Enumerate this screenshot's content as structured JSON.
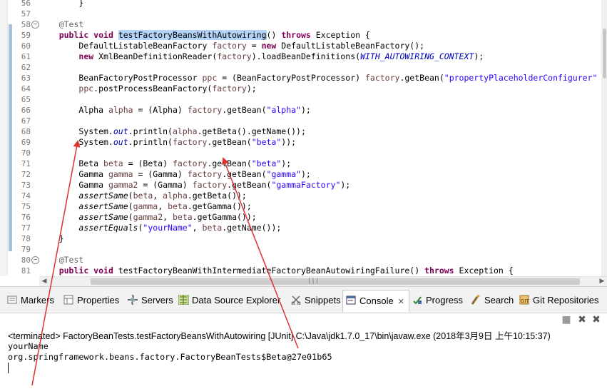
{
  "editor": {
    "lines": [
      {
        "n": "56",
        "parts": [
          [
            "        }",
            ""
          ]
        ]
      },
      {
        "n": "57",
        "parts": [
          [
            "",
            ""
          ]
        ]
      },
      {
        "n": "58",
        "fold": "−",
        "parts": [
          [
            "    ",
            ""
          ],
          [
            "@Test",
            "ann"
          ]
        ]
      },
      {
        "n": "59",
        "parts": [
          [
            "    ",
            ""
          ],
          [
            "public void",
            "kw"
          ],
          [
            " ",
            ""
          ],
          [
            "testFactoryBeansWithAutowiring",
            "sel"
          ],
          [
            "() ",
            ""
          ],
          [
            "throws",
            "kw"
          ],
          [
            " Exception {",
            ""
          ]
        ]
      },
      {
        "n": "60",
        "parts": [
          [
            "        DefaultListableBeanFactory ",
            ""
          ],
          [
            "factory",
            "vr"
          ],
          [
            " = ",
            ""
          ],
          [
            "new",
            "kw"
          ],
          [
            " DefaultListableBeanFactory();",
            ""
          ]
        ]
      },
      {
        "n": "61",
        "parts": [
          [
            "        ",
            ""
          ],
          [
            "new",
            "kw"
          ],
          [
            " XmlBeanDefinitionReader(",
            ""
          ],
          [
            "factory",
            "vr"
          ],
          [
            ").loadBeanDefinitions(",
            ""
          ],
          [
            "WITH_AUTOWIRING_CONTEXT",
            "fld"
          ],
          [
            ");",
            ""
          ]
        ]
      },
      {
        "n": "62",
        "parts": [
          [
            "",
            ""
          ]
        ]
      },
      {
        "n": "63",
        "parts": [
          [
            "        BeanFactoryPostProcessor ",
            ""
          ],
          [
            "ppc",
            "vr"
          ],
          [
            " = (BeanFactoryPostProcessor) ",
            ""
          ],
          [
            "factory",
            "vr"
          ],
          [
            ".getBean(",
            ""
          ],
          [
            "\"propertyPlaceholderConfigurer\"",
            "str"
          ]
        ]
      },
      {
        "n": "64",
        "parts": [
          [
            "        ",
            ""
          ],
          [
            "ppc",
            "vr"
          ],
          [
            ".postProcessBeanFactory(",
            ""
          ],
          [
            "factory",
            "vr"
          ],
          [
            ");",
            ""
          ]
        ]
      },
      {
        "n": "65",
        "parts": [
          [
            "",
            ""
          ]
        ]
      },
      {
        "n": "66",
        "parts": [
          [
            "        Alpha ",
            ""
          ],
          [
            "alpha",
            "vr"
          ],
          [
            " = (Alpha) ",
            ""
          ],
          [
            "factory",
            "vr"
          ],
          [
            ".getBean(",
            ""
          ],
          [
            "\"alpha\"",
            "str"
          ],
          [
            ");",
            ""
          ]
        ]
      },
      {
        "n": "67",
        "parts": [
          [
            "",
            ""
          ]
        ]
      },
      {
        "n": "68",
        "parts": [
          [
            "        System.",
            ""
          ],
          [
            "out",
            "fld"
          ],
          [
            ".println(",
            ""
          ],
          [
            "alpha",
            "vr"
          ],
          [
            ".getBeta().getName());",
            ""
          ]
        ]
      },
      {
        "n": "69",
        "parts": [
          [
            "        System.",
            ""
          ],
          [
            "out",
            "fld"
          ],
          [
            ".println(",
            ""
          ],
          [
            "factory",
            "vr"
          ],
          [
            ".getBean(",
            ""
          ],
          [
            "\"beta\"",
            "str"
          ],
          [
            "));",
            ""
          ]
        ]
      },
      {
        "n": "70",
        "parts": [
          [
            "",
            ""
          ]
        ]
      },
      {
        "n": "71",
        "parts": [
          [
            "        Beta ",
            ""
          ],
          [
            "beta",
            "vr"
          ],
          [
            " = (Beta) ",
            ""
          ],
          [
            "factory",
            "vr"
          ],
          [
            ".getBean(",
            ""
          ],
          [
            "\"beta\"",
            "str"
          ],
          [
            ");",
            ""
          ]
        ]
      },
      {
        "n": "72",
        "parts": [
          [
            "        Gamma ",
            ""
          ],
          [
            "gamma",
            "vr"
          ],
          [
            " = (Gamma) ",
            ""
          ],
          [
            "factory",
            "vr"
          ],
          [
            ".getBean(",
            ""
          ],
          [
            "\"gamma\"",
            "str"
          ],
          [
            ");",
            ""
          ]
        ]
      },
      {
        "n": "73",
        "parts": [
          [
            "        Gamma ",
            ""
          ],
          [
            "gamma2",
            "vr"
          ],
          [
            " = (Gamma) ",
            ""
          ],
          [
            "factory",
            "vr"
          ],
          [
            ".getBean(",
            ""
          ],
          [
            "\"gammaFactory\"",
            "str"
          ],
          [
            ");",
            ""
          ]
        ]
      },
      {
        "n": "74",
        "parts": [
          [
            "        ",
            ""
          ],
          [
            "assertSame",
            "st"
          ],
          [
            "(",
            ""
          ],
          [
            "beta",
            "vr"
          ],
          [
            ", ",
            ""
          ],
          [
            "alpha",
            "vr"
          ],
          [
            ".getBeta());",
            ""
          ]
        ]
      },
      {
        "n": "75",
        "parts": [
          [
            "        ",
            ""
          ],
          [
            "assertSame",
            "st"
          ],
          [
            "(",
            ""
          ],
          [
            "gamma",
            "vr"
          ],
          [
            ", ",
            ""
          ],
          [
            "beta",
            "vr"
          ],
          [
            ".getGamma());",
            ""
          ]
        ]
      },
      {
        "n": "76",
        "parts": [
          [
            "        ",
            ""
          ],
          [
            "assertSame",
            "st"
          ],
          [
            "(",
            ""
          ],
          [
            "gamma2",
            "vr"
          ],
          [
            ", ",
            ""
          ],
          [
            "beta",
            "vr"
          ],
          [
            ".getGamma());",
            ""
          ]
        ]
      },
      {
        "n": "77",
        "parts": [
          [
            "        ",
            ""
          ],
          [
            "assertEquals",
            "st"
          ],
          [
            "(",
            ""
          ],
          [
            "\"yourName\"",
            "str"
          ],
          [
            ", ",
            ""
          ],
          [
            "beta",
            "vr"
          ],
          [
            ".getName());",
            ""
          ]
        ]
      },
      {
        "n": "78",
        "parts": [
          [
            "    }",
            ""
          ]
        ]
      },
      {
        "n": "79",
        "parts": [
          [
            "",
            ""
          ]
        ]
      },
      {
        "n": "80",
        "fold": "−",
        "parts": [
          [
            "    ",
            ""
          ],
          [
            "@Test",
            "ann"
          ]
        ]
      },
      {
        "n": "81",
        "parts": [
          [
            "    ",
            ""
          ],
          [
            "public void",
            "kw"
          ],
          [
            " testFactoryBeanWithIntermediateFactoryBeanAutowiringFailure() ",
            ""
          ],
          [
            "throws",
            "kw"
          ],
          [
            " Exception {",
            ""
          ]
        ]
      }
    ],
    "hscroll_grip": "|||"
  },
  "tabs": [
    {
      "label": "Markers",
      "icon": "markers-icon"
    },
    {
      "label": "Properties",
      "icon": "properties-icon"
    },
    {
      "label": "Servers",
      "icon": "servers-icon"
    },
    {
      "label": "Data Source Explorer",
      "icon": "data-source-icon"
    },
    {
      "label": "Snippets",
      "icon": "snippets-icon"
    },
    {
      "label": "Console",
      "icon": "console-icon",
      "active": true,
      "close": "✕"
    },
    {
      "label": "Progress",
      "icon": "progress-icon"
    },
    {
      "label": "Search",
      "icon": "search-icon"
    },
    {
      "label": "Git Repositories",
      "icon": "git-icon"
    }
  ],
  "console": {
    "header": "<terminated> FactoryBeanTests.testFactoryBeansWithAutowiring [JUnit] C:\\Java\\jdk1.7.0_17\\bin\\javaw.exe (2018年3月9日 上午10:15:37)",
    "output": [
      "yourName",
      "org.springframework.beans.factory.FactoryBeanTests$Beta@27e01b65"
    ]
  },
  "colors": {
    "annotation_arrow": "#e03030",
    "selection": "#b4d3f6",
    "keyword": "#7f0055",
    "string": "#2a00ff"
  }
}
